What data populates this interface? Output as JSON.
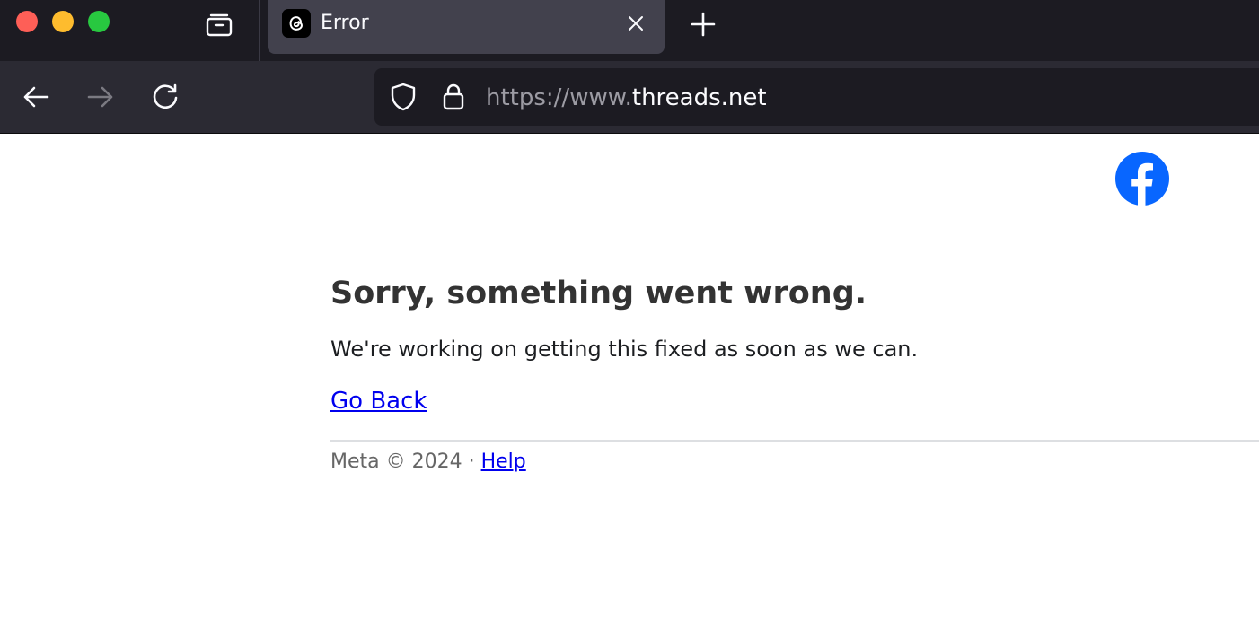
{
  "browser": {
    "tab": {
      "title": "Error",
      "favicon": "threads-icon"
    },
    "toolbar_icons": [
      "arrow-left-icon",
      "arrow-right-icon",
      "reload-icon",
      "shield-icon",
      "lock-icon"
    ],
    "address": {
      "prefix": "https://www.",
      "host": "threads.net"
    }
  },
  "page": {
    "logo": "facebook-icon",
    "title": "Sorry, something went wrong.",
    "message": "We're working on getting this fixed as soon as we can.",
    "go_back_label": "Go Back",
    "footer": {
      "text": "Meta © 2024 · ",
      "help_label": "Help"
    }
  },
  "colors": {
    "tabstrip_bg": "#1c1b22",
    "active_tab_bg": "#42414d",
    "navbar_bg": "#2b2a33",
    "link": "#0000ee",
    "facebook_blue": "#0866ff",
    "title_text": "#333333"
  }
}
